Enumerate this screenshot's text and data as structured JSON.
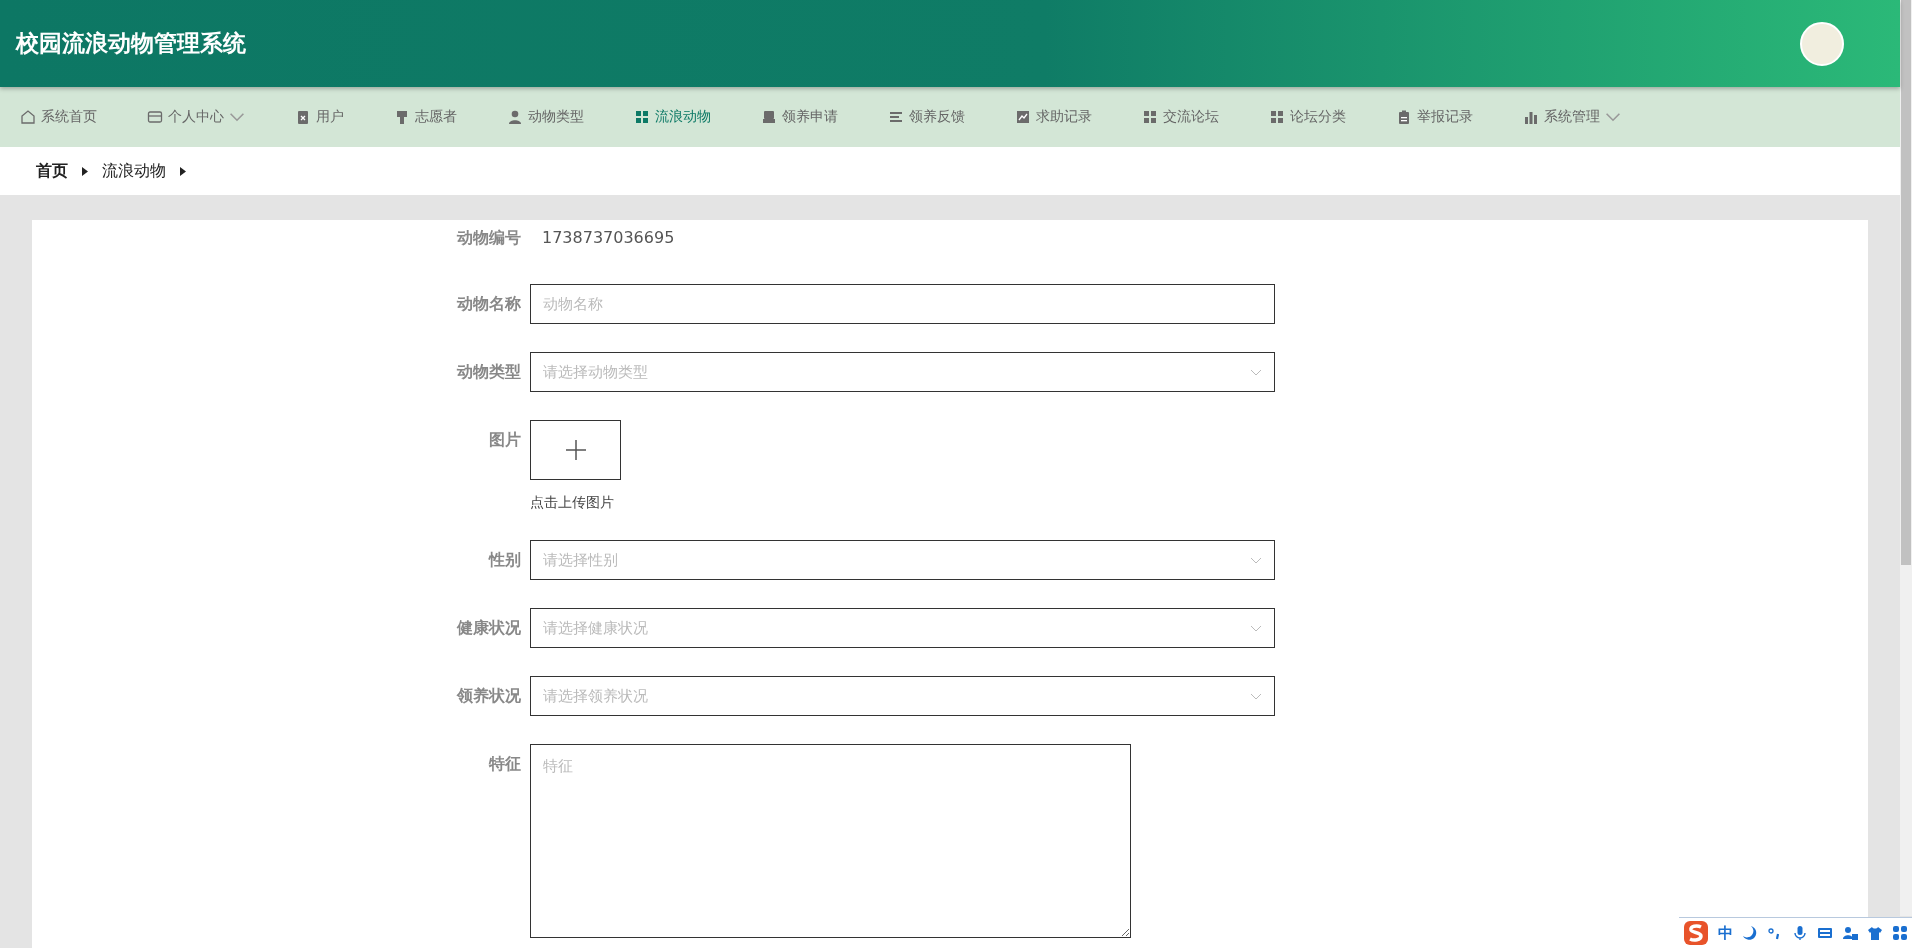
{
  "header": {
    "title": "校园流浪动物管理系统"
  },
  "nav": [
    {
      "label": "系统首页",
      "selected": false,
      "dropdown": false
    },
    {
      "label": "个人中心",
      "selected": false,
      "dropdown": true
    },
    {
      "label": "用户",
      "selected": false,
      "dropdown": false
    },
    {
      "label": "志愿者",
      "selected": false,
      "dropdown": false
    },
    {
      "label": "动物类型",
      "selected": false,
      "dropdown": false
    },
    {
      "label": "流浪动物",
      "selected": true,
      "dropdown": false
    },
    {
      "label": "领养申请",
      "selected": false,
      "dropdown": false
    },
    {
      "label": "领养反馈",
      "selected": false,
      "dropdown": false
    },
    {
      "label": "求助记录",
      "selected": false,
      "dropdown": false
    },
    {
      "label": "交流论坛",
      "selected": false,
      "dropdown": false
    },
    {
      "label": "论坛分类",
      "selected": false,
      "dropdown": false
    },
    {
      "label": "举报记录",
      "selected": false,
      "dropdown": false
    },
    {
      "label": "系统管理",
      "selected": false,
      "dropdown": true
    }
  ],
  "breadcrumb": [
    "首页",
    "流浪动物"
  ],
  "form": [
    {
      "kind": "text",
      "label": "动物编号",
      "value": "1738737036695"
    },
    {
      "kind": "input",
      "label": "动物名称",
      "placeholder": "动物名称"
    },
    {
      "kind": "select",
      "label": "动物类型",
      "placeholder": "请选择动物类型"
    },
    {
      "kind": "upload",
      "label": "图片",
      "caption": "点击上传图片"
    },
    {
      "kind": "select",
      "label": "性别",
      "placeholder": "请选择性别"
    },
    {
      "kind": "select",
      "label": "健康状况",
      "placeholder": "请选择健康状况"
    },
    {
      "kind": "select",
      "label": "领养状况",
      "placeholder": "请选择领养状况"
    },
    {
      "kind": "textarea",
      "label": "特征",
      "placeholder": "特征"
    }
  ],
  "ime_bar": {
    "mode": "中"
  }
}
